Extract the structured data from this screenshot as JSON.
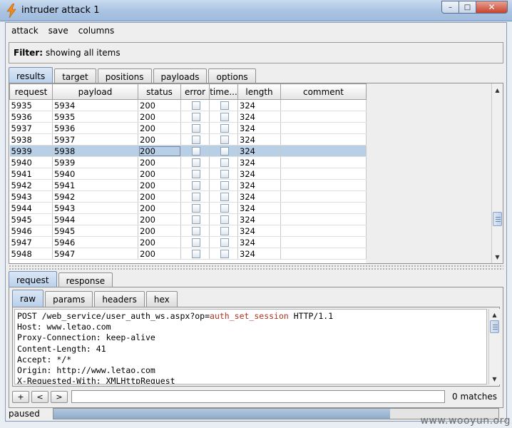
{
  "window": {
    "title": "intruder attack 1",
    "controls": {
      "minimize": "–",
      "maximize": "□",
      "close": "✕"
    }
  },
  "menu": [
    "attack",
    "save",
    "columns"
  ],
  "filter": {
    "label": "Filter:",
    "value": "showing all items"
  },
  "main_tabs": [
    {
      "label": "results",
      "active": true
    },
    {
      "label": "target",
      "active": false
    },
    {
      "label": "positions",
      "active": false
    },
    {
      "label": "payloads",
      "active": false
    },
    {
      "label": "options",
      "active": false
    }
  ],
  "table": {
    "columns": [
      "request",
      "payload",
      "status",
      "error",
      "time...",
      "length",
      "comment"
    ],
    "rows": [
      {
        "request": "5935",
        "payload": "5934",
        "status": "200",
        "length": "324",
        "comment": ""
      },
      {
        "request": "5936",
        "payload": "5935",
        "status": "200",
        "length": "324",
        "comment": ""
      },
      {
        "request": "5937",
        "payload": "5936",
        "status": "200",
        "length": "324",
        "comment": ""
      },
      {
        "request": "5938",
        "payload": "5937",
        "status": "200",
        "length": "324",
        "comment": ""
      },
      {
        "request": "5939",
        "payload": "5938",
        "status": "200",
        "length": "324",
        "comment": "",
        "selected": true
      },
      {
        "request": "5940",
        "payload": "5939",
        "status": "200",
        "length": "324",
        "comment": ""
      },
      {
        "request": "5941",
        "payload": "5940",
        "status": "200",
        "length": "324",
        "comment": ""
      },
      {
        "request": "5942",
        "payload": "5941",
        "status": "200",
        "length": "324",
        "comment": ""
      },
      {
        "request": "5943",
        "payload": "5942",
        "status": "200",
        "length": "324",
        "comment": ""
      },
      {
        "request": "5944",
        "payload": "5943",
        "status": "200",
        "length": "324",
        "comment": ""
      },
      {
        "request": "5945",
        "payload": "5944",
        "status": "200",
        "length": "324",
        "comment": ""
      },
      {
        "request": "5946",
        "payload": "5945",
        "status": "200",
        "length": "324",
        "comment": ""
      },
      {
        "request": "5947",
        "payload": "5946",
        "status": "200",
        "length": "324",
        "comment": ""
      },
      {
        "request": "5948",
        "payload": "5947",
        "status": "200",
        "length": "324",
        "comment": ""
      }
    ]
  },
  "lower_tabs": [
    {
      "label": "request",
      "active": true
    },
    {
      "label": "response",
      "active": false
    }
  ],
  "view_tabs": [
    {
      "label": "raw",
      "active": true
    },
    {
      "label": "params",
      "active": false
    },
    {
      "label": "headers",
      "active": false
    },
    {
      "label": "hex",
      "active": false
    }
  ],
  "request_lines": [
    {
      "pre": "POST /web_service/user_auth_ws.aspx?op=",
      "hl": "auth_set_session",
      "post": " HTTP/1.1"
    },
    {
      "pre": "Host: www.letao.com",
      "hl": "",
      "post": ""
    },
    {
      "pre": "Proxy-Connection: keep-alive",
      "hl": "",
      "post": ""
    },
    {
      "pre": "Content-Length: 41",
      "hl": "",
      "post": ""
    },
    {
      "pre": "Accept: */*",
      "hl": "",
      "post": ""
    },
    {
      "pre": "Origin: http://www.letao.com",
      "hl": "",
      "post": ""
    },
    {
      "pre": "X-Requested-With: XMLHttpRequest",
      "hl": "",
      "post": ""
    }
  ],
  "search": {
    "buttons": [
      "+",
      "<",
      ">"
    ],
    "value": "",
    "matches": "0 matches"
  },
  "status": {
    "text": "paused",
    "progress": 0.757
  },
  "watermark": "www.wooyun.org",
  "colors": {
    "accent": "#b8cfe5",
    "highlight_text": "#b0321f",
    "progress_fill": "#8eaacb"
  }
}
